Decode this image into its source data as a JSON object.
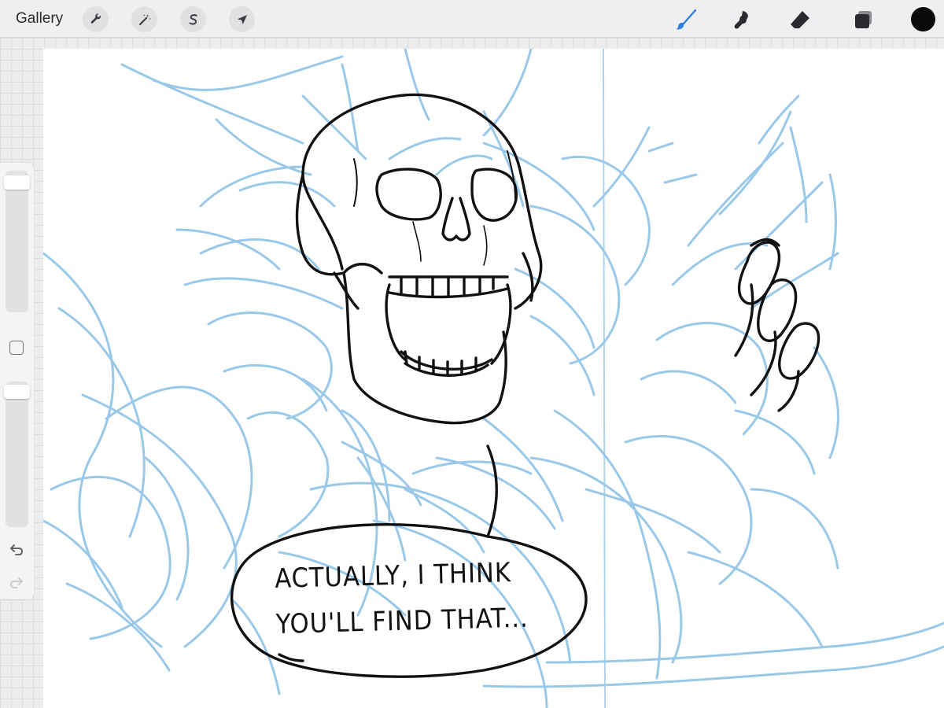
{
  "toolbar": {
    "gallery_label": "Gallery",
    "left_tools": [
      {
        "icon": "wrench-icon",
        "name": "actions"
      },
      {
        "icon": "magic-wand-icon",
        "name": "adjustments"
      },
      {
        "icon": "selection-s-icon",
        "name": "selection"
      },
      {
        "icon": "arrow-cursor-icon",
        "name": "transform"
      }
    ],
    "right_tools": [
      {
        "icon": "brush-icon",
        "name": "paint",
        "active": true
      },
      {
        "icon": "smudge-icon",
        "name": "smudge"
      },
      {
        "icon": "eraser-icon",
        "name": "erase"
      },
      {
        "icon": "layers-icon",
        "name": "layers"
      }
    ],
    "active_color": "#0a0a0a",
    "brush_accent": "#2f7fe0"
  },
  "sidebar": {
    "brush_size": 0.95,
    "opacity": 0.95,
    "modify_button": "square-icon",
    "undo_icon": "undo-icon",
    "redo_icon": "redo-icon"
  },
  "canvas": {
    "speech_bubble": {
      "line1": "ACTUALLY, I THINK",
      "line2": "YOU'LL FIND THAT..."
    },
    "sketch_color": "#8fc3e6",
    "ink_color": "#111111"
  }
}
